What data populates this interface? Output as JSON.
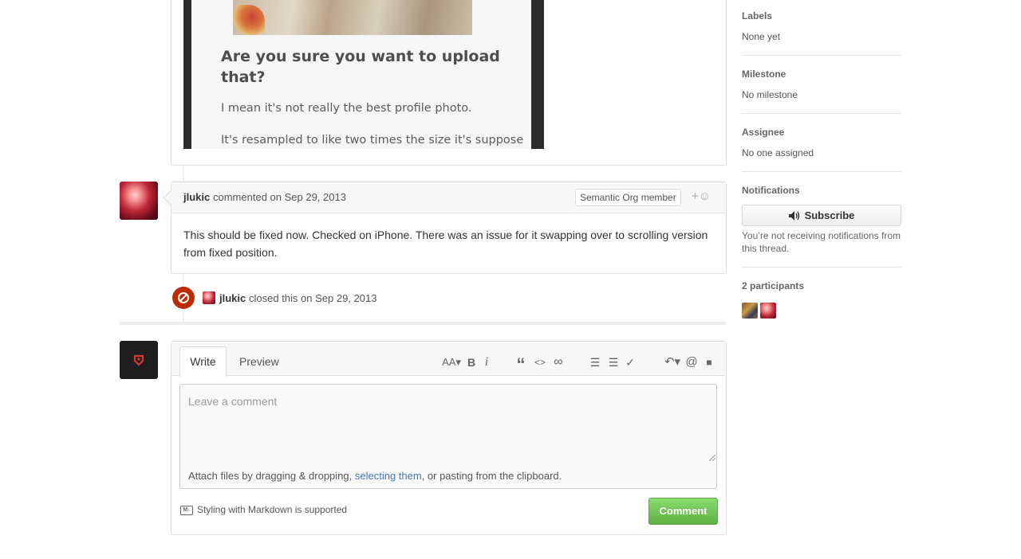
{
  "embedded_screenshot": {
    "title": "Are you sure you want to upload that?",
    "paragraph_1": "I mean it's not really the best profile photo.",
    "paragraph_2": "It's resampled to like two times the size it's suppose"
  },
  "comment": {
    "author": "jlukic",
    "meta": "commented on Sep 29, 2013",
    "badge": "Semantic Org member",
    "reaction_icon": "+☺",
    "body": "This should be fixed now. Checked on iPhone. There was an issue for it swapping over to scrolling version from fixed position."
  },
  "event": {
    "author": "jlukic",
    "text": "closed this on Sep 29, 2013",
    "icon": "circle-slash-icon",
    "color": "#bd2c00"
  },
  "form": {
    "tab_write": "Write",
    "tab_preview": "Preview",
    "toolbar": {
      "header": "AA▾",
      "bold": "B",
      "italic": "i",
      "quote": "“",
      "code": "<>",
      "link": "∞",
      "ul": "☰",
      "ol": "☰",
      "task": "✓",
      "reply": "↶▾",
      "mention": "@",
      "bookmark": "■"
    },
    "placeholder": "Leave a comment",
    "attach_prefix": "Attach files by dragging & dropping, ",
    "attach_link": "selecting them",
    "attach_suffix": ", or pasting from the clipboard.",
    "markdown_icon": "M↓",
    "markdown_note": "Styling with Markdown is supported",
    "submit": "Comment",
    "submit_color": "#6cc644"
  },
  "sidebar": {
    "labels_heading": "Labels",
    "labels_value": "None yet",
    "milestone_heading": "Milestone",
    "milestone_value": "No milestone",
    "assignee_heading": "Assignee",
    "assignee_value": "No one assigned",
    "notifications_heading": "Notifications",
    "subscribe_label": "Subscribe",
    "notifications_note": "You’re not receiving notifications from this thread.",
    "participants_heading": "2 participants"
  },
  "link_color": "#4078c0"
}
